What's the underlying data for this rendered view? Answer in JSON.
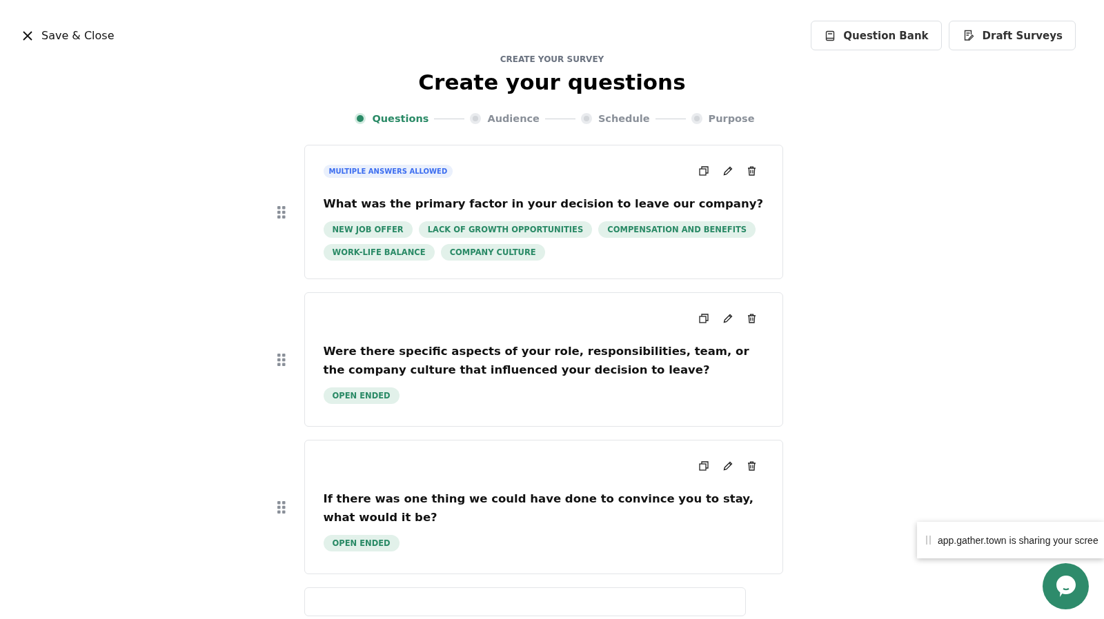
{
  "header": {
    "close_label": "Save & Close",
    "buttons": [
      {
        "label": "Question Bank",
        "kind": "bank"
      },
      {
        "label": "Draft Surveys",
        "kind": "draft"
      }
    ]
  },
  "eyebrow": "CREATE YOUR SURVEY",
  "title": "Create your questions",
  "steps": [
    {
      "label": "Questions",
      "selected": true
    },
    {
      "label": "Audience",
      "selected": false
    },
    {
      "label": "Schedule",
      "selected": false
    },
    {
      "label": "Purpose",
      "selected": false
    }
  ],
  "questions": [
    {
      "badge": "MULTIPLE ANSWERS ALLOWED",
      "text": "What was the primary factor in your decision to leave our company?",
      "tags": [
        "NEW JOB OFFER",
        "LACK OF GROWTH OPPORTUNITIES",
        "COMPENSATION AND BENEFITS",
        "WORK-LIFE BALANCE",
        "COMPANY CULTURE"
      ]
    },
    {
      "text": "Were there specific aspects of your role, responsibilities, team, or the company culture that influenced your decision to leave?",
      "tags": [
        "OPEN ENDED"
      ]
    },
    {
      "text": "If there was one thing we could have done to convince you to stay, what would it be?",
      "tags": [
        "OPEN ENDED"
      ]
    }
  ],
  "sharing_banner": "app.gather.town is sharing your scree"
}
